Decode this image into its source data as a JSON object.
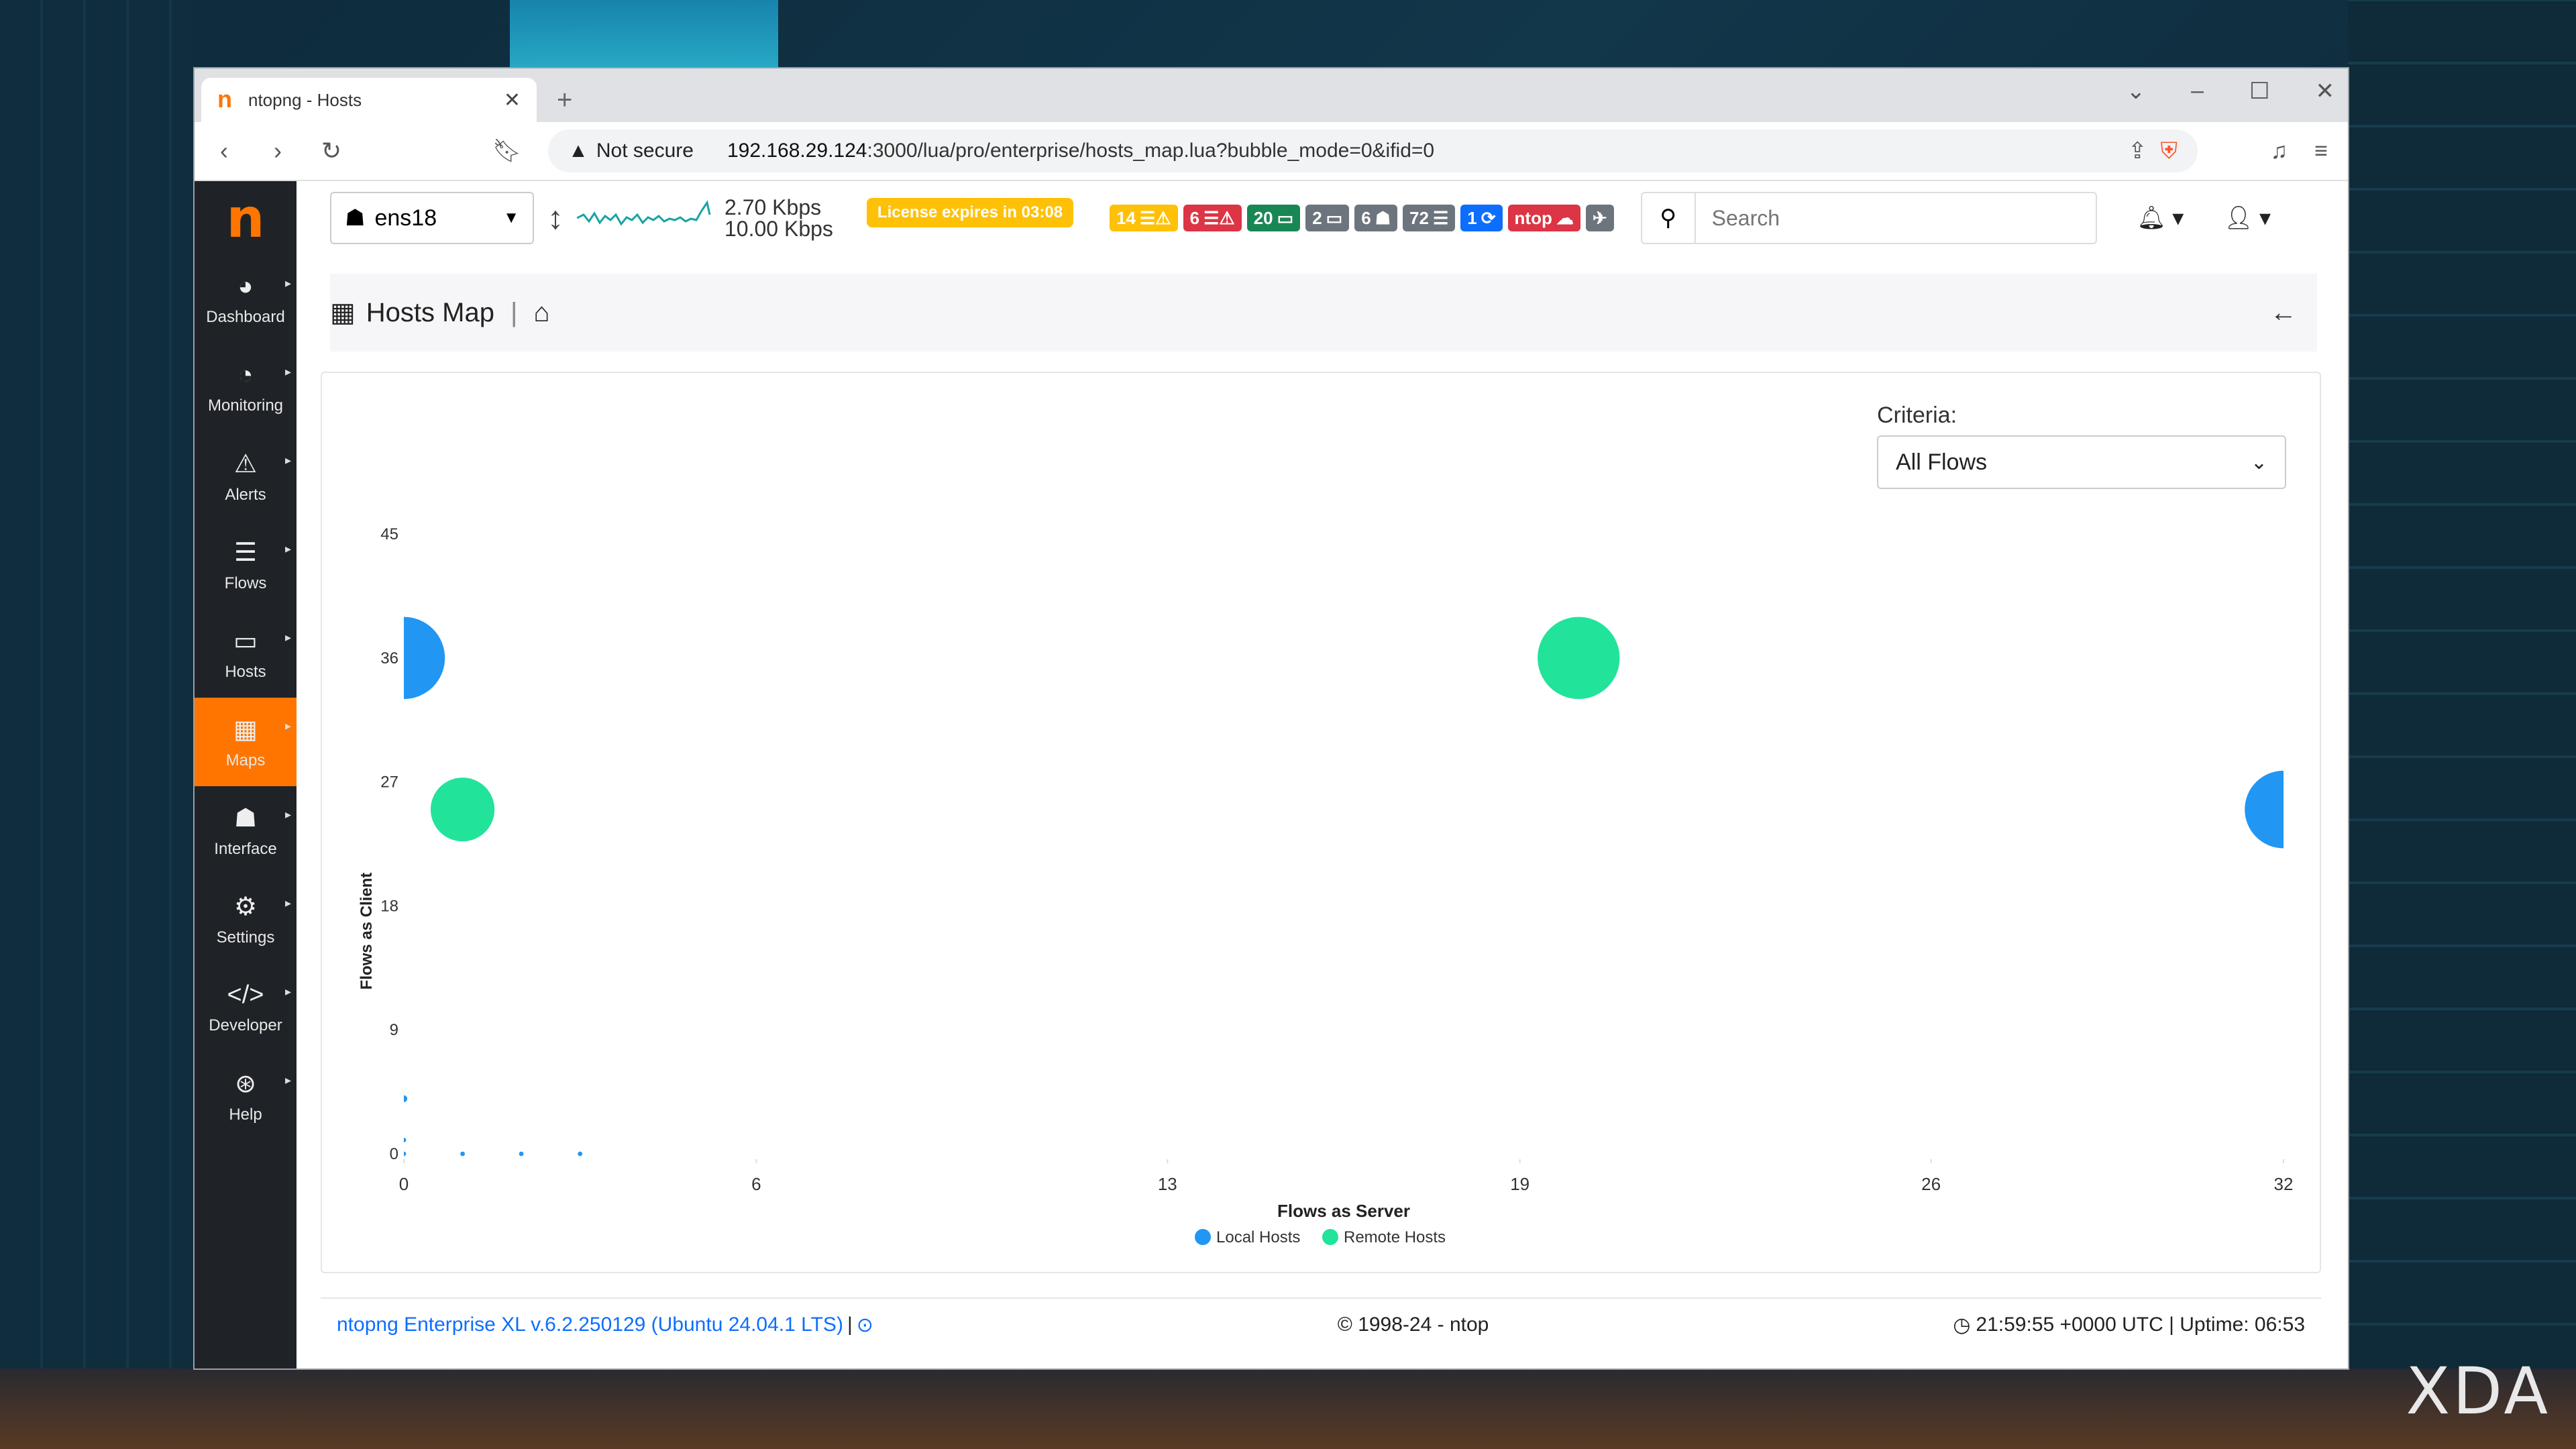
{
  "browser": {
    "tab_title": "ntopng - Hosts",
    "new_tab": "+",
    "security_label": "Not secure",
    "url_host": "192.168.29.124",
    "url_path": ":3000/lua/pro/enterprise/hosts_map.lua?bubble_mode=0&ifid=0"
  },
  "sidebar": {
    "logo": "n",
    "items": [
      {
        "label": "Dashboard",
        "icon": "dashboard-icon"
      },
      {
        "label": "Monitoring",
        "icon": "monitoring-icon"
      },
      {
        "label": "Alerts",
        "icon": "alerts-icon"
      },
      {
        "label": "Flows",
        "icon": "flows-icon"
      },
      {
        "label": "Hosts",
        "icon": "hosts-icon"
      },
      {
        "label": "Maps",
        "icon": "maps-icon",
        "active": true
      },
      {
        "label": "Interface",
        "icon": "interface-icon"
      },
      {
        "label": "Settings",
        "icon": "settings-icon"
      },
      {
        "label": "Developer",
        "icon": "developer-icon"
      },
      {
        "label": "Help",
        "icon": "help-icon"
      }
    ]
  },
  "topbar": {
    "interface": "ens18",
    "rate_up": "2.70 Kbps",
    "rate_down": "10.00 Kbps",
    "license": "License expires in 03:08",
    "badges": [
      {
        "text": "14",
        "icon": "flows-warning-icon",
        "color": "#ffc107"
      },
      {
        "text": "6",
        "icon": "flows-error-icon",
        "color": "#dc3545"
      },
      {
        "text": "20",
        "icon": "local-hosts-icon",
        "color": "#198754"
      },
      {
        "text": "2",
        "icon": "remote-hosts-icon",
        "color": "#6c757d"
      },
      {
        "text": "6",
        "icon": "devices-icon",
        "color": "#6c757d"
      },
      {
        "text": "72",
        "icon": "flows-icon",
        "color": "#6c757d"
      },
      {
        "text": "1",
        "icon": "sync-icon",
        "color": "#0d6efd"
      },
      {
        "text": "ntop",
        "icon": "cloud-icon",
        "color": "#dc3545"
      },
      {
        "text": "",
        "icon": "plane-icon",
        "color": "#6c757d"
      }
    ],
    "search_placeholder": "Search"
  },
  "page": {
    "title": "Hosts Map",
    "sep": "|"
  },
  "criteria": {
    "label": "Criteria:",
    "selected": "All Flows"
  },
  "chart_data": {
    "type": "scatter",
    "xlabel": "Flows as Server",
    "ylabel": "Flows as Client",
    "x_ticks": [
      "0",
      "6",
      "13",
      "19",
      "26",
      "32"
    ],
    "y_ticks": [
      "0",
      "9",
      "18",
      "27",
      "36",
      "45"
    ],
    "xlim": [
      0,
      32
    ],
    "ylim": [
      0,
      45
    ],
    "series": [
      {
        "name": "Local Hosts",
        "color": "#2196f3",
        "points": [
          {
            "x": 0,
            "y": 36,
            "r": 36
          },
          {
            "x": 32,
            "y": 25,
            "r": 34
          },
          {
            "x": 0,
            "y": 4,
            "r": 3
          },
          {
            "x": 0,
            "y": 1,
            "r": 2
          },
          {
            "x": 0,
            "y": 0,
            "r": 2
          },
          {
            "x": 1,
            "y": 0,
            "r": 2
          },
          {
            "x": 2,
            "y": 0,
            "r": 2
          },
          {
            "x": 3,
            "y": 0,
            "r": 2
          }
        ]
      },
      {
        "name": "Remote Hosts",
        "color": "#22e39a",
        "points": [
          {
            "x": 1,
            "y": 25,
            "r": 28
          },
          {
            "x": 20,
            "y": 36,
            "r": 36
          }
        ]
      }
    ]
  },
  "footer": {
    "version": "ntopng Enterprise XL v.6.2.250129 (Ubuntu 24.04.1 LTS)",
    "version_sep": "|",
    "copyright": "© 1998-24 - ntop",
    "clock": "21:59:55 +0000 UTC | Uptime: 06:53"
  },
  "watermark": "XDA"
}
